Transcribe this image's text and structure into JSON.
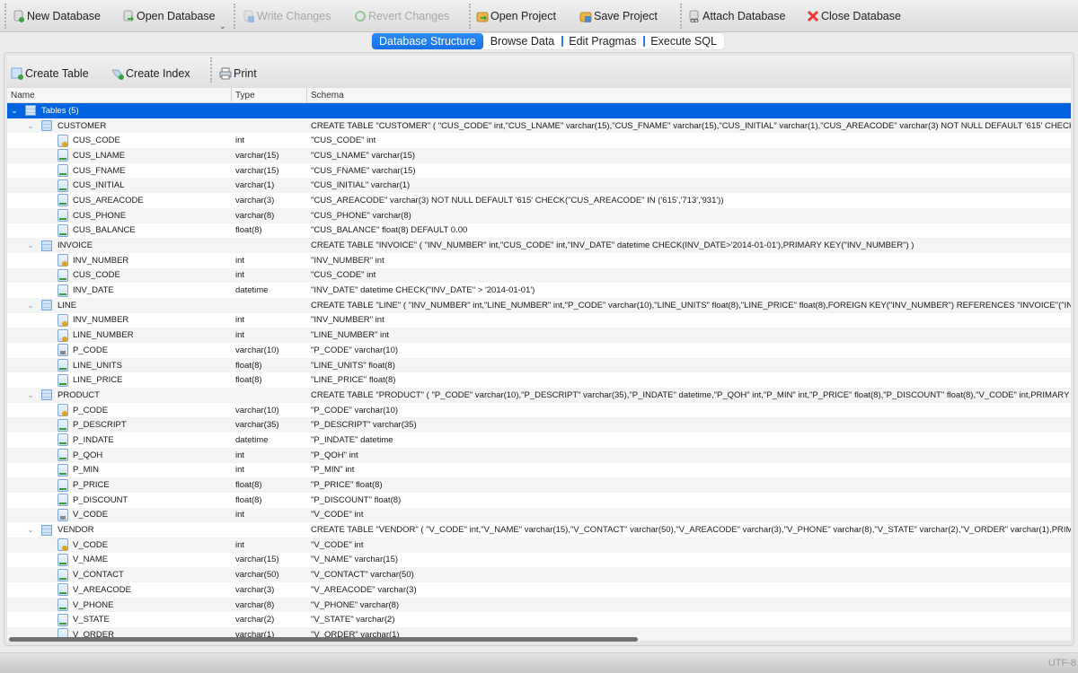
{
  "toolbar": {
    "new_database": "New Database",
    "open_database": "Open Database",
    "write_changes": "Write Changes",
    "revert_changes": "Revert Changes",
    "open_project": "Open Project",
    "save_project": "Save Project",
    "attach_database": "Attach Database",
    "close_database": "Close Database",
    "dropdown_arrow": "⌄"
  },
  "tabs": [
    {
      "label": "Database Structure",
      "active": true
    },
    {
      "label": "Browse Data",
      "active": false
    },
    {
      "label": "Edit Pragmas",
      "active": false
    },
    {
      "label": "Execute SQL",
      "active": false
    }
  ],
  "structure_toolbar": {
    "create_table": "Create Table",
    "create_index": "Create Index",
    "print": "Print"
  },
  "columns": {
    "name": "Name",
    "type": "Type",
    "schema": "Schema"
  },
  "tree": {
    "root_label": "Tables (5)",
    "rows": [
      {
        "level": 1,
        "kind": "table",
        "name": "CUSTOMER",
        "type": "",
        "schema": "CREATE TABLE \"CUSTOMER\" ( \"CUS_CODE\" int,\"CUS_LNAME\" varchar(15),\"CUS_FNAME\" varchar(15),\"CUS_INITIAL\" varchar(1),\"CUS_AREACODE\" varchar(3) NOT NULL DEFAULT '615' CHECK(CUS_AREACODE"
      },
      {
        "level": 2,
        "kind": "key",
        "name": "CUS_CODE",
        "type": "int",
        "schema": "\"CUS_CODE\" int"
      },
      {
        "level": 2,
        "kind": "field",
        "name": "CUS_LNAME",
        "type": "varchar(15)",
        "schema": "\"CUS_LNAME\" varchar(15)"
      },
      {
        "level": 2,
        "kind": "field",
        "name": "CUS_FNAME",
        "type": "varchar(15)",
        "schema": "\"CUS_FNAME\" varchar(15)"
      },
      {
        "level": 2,
        "kind": "field",
        "name": "CUS_INITIAL",
        "type": "varchar(1)",
        "schema": "\"CUS_INITIAL\" varchar(1)"
      },
      {
        "level": 2,
        "kind": "field",
        "name": "CUS_AREACODE",
        "type": "varchar(3)",
        "schema": "\"CUS_AREACODE\" varchar(3) NOT NULL DEFAULT '615' CHECK(\"CUS_AREACODE\" IN ('615','713','931'))"
      },
      {
        "level": 2,
        "kind": "field",
        "name": "CUS_PHONE",
        "type": "varchar(8)",
        "schema": "\"CUS_PHONE\" varchar(8)"
      },
      {
        "level": 2,
        "kind": "field",
        "name": "CUS_BALANCE",
        "type": "float(8)",
        "schema": "\"CUS_BALANCE\" float(8) DEFAULT 0.00"
      },
      {
        "level": 1,
        "kind": "table",
        "name": "INVOICE",
        "type": "",
        "schema": "CREATE TABLE \"INVOICE\" ( \"INV_NUMBER\" int,\"CUS_CODE\" int,\"INV_DATE\" datetime CHECK(INV_DATE>'2014-01-01'),PRIMARY KEY(\"INV_NUMBER\") )"
      },
      {
        "level": 2,
        "kind": "key",
        "name": "INV_NUMBER",
        "type": "int",
        "schema": "\"INV_NUMBER\" int"
      },
      {
        "level": 2,
        "kind": "field",
        "name": "CUS_CODE",
        "type": "int",
        "schema": "\"CUS_CODE\" int"
      },
      {
        "level": 2,
        "kind": "field",
        "name": "INV_DATE",
        "type": "datetime",
        "schema": "\"INV_DATE\" datetime CHECK(\"INV_DATE\" > '2014-01-01')"
      },
      {
        "level": 1,
        "kind": "table",
        "name": "LINE",
        "type": "",
        "schema": "CREATE TABLE \"LINE\" ( \"INV_NUMBER\" int,\"LINE_NUMBER\" int,\"P_CODE\" varchar(10),\"LINE_UNITS\" float(8),\"LINE_PRICE\" float(8),FOREIGN KEY(\"INV_NUMBER\") REFERENCES \"INVOICE\"(\"INV_NUMBER\") ON"
      },
      {
        "level": 2,
        "kind": "key",
        "name": "INV_NUMBER",
        "type": "int",
        "schema": "\"INV_NUMBER\" int"
      },
      {
        "level": 2,
        "kind": "key",
        "name": "LINE_NUMBER",
        "type": "int",
        "schema": "\"LINE_NUMBER\" int"
      },
      {
        "level": 2,
        "kind": "fk",
        "name": "P_CODE",
        "type": "varchar(10)",
        "schema": "\"P_CODE\" varchar(10)"
      },
      {
        "level": 2,
        "kind": "field",
        "name": "LINE_UNITS",
        "type": "float(8)",
        "schema": "\"LINE_UNITS\" float(8)"
      },
      {
        "level": 2,
        "kind": "field",
        "name": "LINE_PRICE",
        "type": "float(8)",
        "schema": "\"LINE_PRICE\" float(8)"
      },
      {
        "level": 1,
        "kind": "table",
        "name": "PRODUCT",
        "type": "",
        "schema": "CREATE TABLE \"PRODUCT\" ( \"P_CODE\" varchar(10),\"P_DESCRIPT\" varchar(35),\"P_INDATE\" datetime,\"P_QOH\" int,\"P_MIN\" int,\"P_PRICE\" float(8),\"P_DISCOUNT\" float(8),\"V_CODE\" int,PRIMARY KEY(\"P_CODE"
      },
      {
        "level": 2,
        "kind": "key",
        "name": "P_CODE",
        "type": "varchar(10)",
        "schema": "\"P_CODE\" varchar(10)"
      },
      {
        "level": 2,
        "kind": "field",
        "name": "P_DESCRIPT",
        "type": "varchar(35)",
        "schema": "\"P_DESCRIPT\" varchar(35)"
      },
      {
        "level": 2,
        "kind": "field",
        "name": "P_INDATE",
        "type": "datetime",
        "schema": "\"P_INDATE\" datetime"
      },
      {
        "level": 2,
        "kind": "field",
        "name": "P_QOH",
        "type": "int",
        "schema": "\"P_QOH\" int"
      },
      {
        "level": 2,
        "kind": "field",
        "name": "P_MIN",
        "type": "int",
        "schema": "\"P_MIN\" int"
      },
      {
        "level": 2,
        "kind": "field",
        "name": "P_PRICE",
        "type": "float(8)",
        "schema": "\"P_PRICE\" float(8)"
      },
      {
        "level": 2,
        "kind": "field",
        "name": "P_DISCOUNT",
        "type": "float(8)",
        "schema": "\"P_DISCOUNT\" float(8)"
      },
      {
        "level": 2,
        "kind": "fk",
        "name": "V_CODE",
        "type": "int",
        "schema": "\"V_CODE\" int"
      },
      {
        "level": 1,
        "kind": "table",
        "name": "VENDOR",
        "type": "",
        "schema": "CREATE TABLE \"VENDOR\" ( \"V_CODE\" int,\"V_NAME\" varchar(15),\"V_CONTACT\" varchar(50),\"V_AREACODE\" varchar(3),\"V_PHONE\" varchar(8),\"V_STATE\" varchar(2),\"V_ORDER\" varchar(1),PRIMARY KEY(\"V_"
      },
      {
        "level": 2,
        "kind": "key",
        "name": "V_CODE",
        "type": "int",
        "schema": "\"V_CODE\" int"
      },
      {
        "level": 2,
        "kind": "field",
        "name": "V_NAME",
        "type": "varchar(15)",
        "schema": "\"V_NAME\" varchar(15)"
      },
      {
        "level": 2,
        "kind": "field",
        "name": "V_CONTACT",
        "type": "varchar(50)",
        "schema": "\"V_CONTACT\" varchar(50)"
      },
      {
        "level": 2,
        "kind": "field",
        "name": "V_AREACODE",
        "type": "varchar(3)",
        "schema": "\"V_AREACODE\" varchar(3)"
      },
      {
        "level": 2,
        "kind": "field",
        "name": "V_PHONE",
        "type": "varchar(8)",
        "schema": "\"V_PHONE\" varchar(8)"
      },
      {
        "level": 2,
        "kind": "field",
        "name": "V_STATE",
        "type": "varchar(2)",
        "schema": "\"V_STATE\" varchar(2)"
      },
      {
        "level": 2,
        "kind": "field",
        "name": "V_ORDER",
        "type": "varchar(1)",
        "schema": "\"V_ORDER\" varchar(1)"
      }
    ]
  },
  "status": {
    "encoding": "UTF-8"
  }
}
